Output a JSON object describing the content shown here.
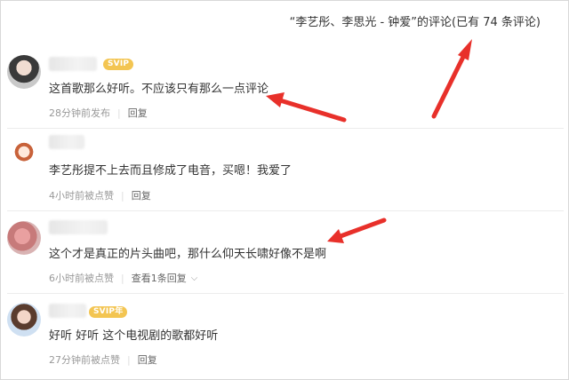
{
  "header": {
    "title": "“李艺彤、李思光 - 钟爱”的评论(已有 74 条评论)"
  },
  "comments": [
    {
      "badge": "SVIP",
      "text": "这首歌那么好听。不应该只有那么一点评论",
      "time": "28分钟前发布",
      "action": "回复"
    },
    {
      "badge": "",
      "text": "李艺彤提不上去而且修成了电音，买嗯！我爱了",
      "time": "4小时前被点赞",
      "action": "回复"
    },
    {
      "badge": "",
      "text": "这个才是真正的片头曲吧，那什么仰天长啸好像不是啊",
      "time": "6小时前被点赞",
      "action": "查看1条回复"
    },
    {
      "badge": "SVIP年",
      "text": "好听 好听 这个电视剧的歌都好听",
      "time": "27分钟前被点赞",
      "action": "回复"
    }
  ],
  "colors": {
    "arrow": "#e8302a",
    "badge": "#f3c552",
    "meta": "#999999"
  },
  "icons": [
    "chevron-down-icon"
  ]
}
